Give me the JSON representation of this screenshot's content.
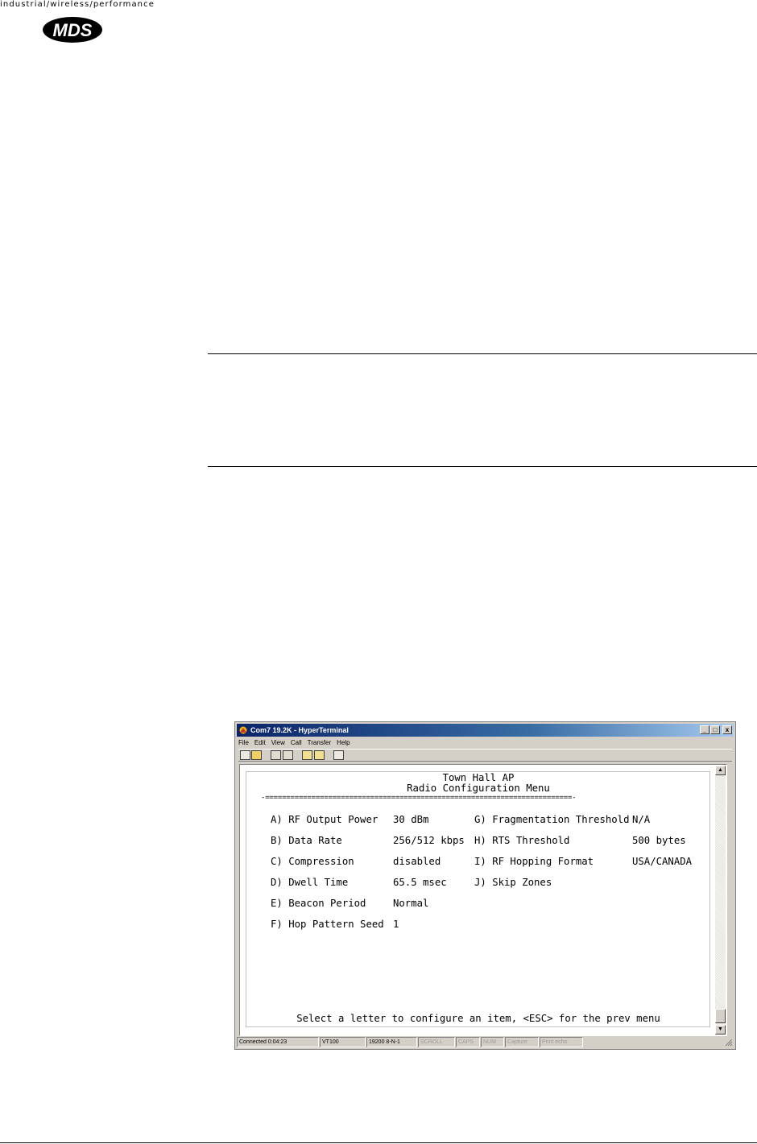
{
  "header": {
    "tagline": "industrial/wireless/performance",
    "logo_text": "MDS"
  },
  "window": {
    "title": "Com7 19.2K - HyperTerminal",
    "controls": {
      "minimize": "_",
      "maximize": "□",
      "close": "x"
    },
    "menu": [
      "File",
      "Edit",
      "View",
      "Call",
      "Transfer",
      "Help"
    ],
    "toolbar_icons": [
      "new-icon",
      "open-icon",
      "phone-icon",
      "disconnect-icon",
      "send-icon",
      "receive-icon",
      "properties-icon"
    ]
  },
  "terminal": {
    "device_name": "Town Hall AP",
    "menu_title": "Radio Configuration Menu",
    "separator": "-=========================================================================-",
    "left_items": [
      {
        "label": "A) RF Output Power",
        "value": "30 dBm"
      },
      {
        "label": "B) Data Rate",
        "value": "256/512 kbps"
      },
      {
        "label": "C) Compression",
        "value": "disabled"
      },
      {
        "label": "D) Dwell Time",
        "value": "65.5 msec"
      },
      {
        "label": "E) Beacon Period",
        "value": "Normal"
      },
      {
        "label": "F) Hop Pattern Seed",
        "value": "1"
      }
    ],
    "right_items": [
      {
        "label": "G) Fragmentation Threshold",
        "value": "N/A"
      },
      {
        "label": "H) RTS Threshold",
        "value": "500 bytes"
      },
      {
        "label": "I) RF Hopping Format",
        "value": "USA/CANADA"
      },
      {
        "label": "J) Skip Zones",
        "value": ""
      }
    ],
    "prompt": "Select a letter to configure an item, <ESC> for the prev menu"
  },
  "status_bar": {
    "connected": "Connected 0:04:23",
    "emulation": "VT100",
    "port_settings": "19200 8-N-1",
    "scroll": "SCROLL",
    "caps": "CAPS",
    "num": "NUM",
    "capture": "Capture",
    "print_echo": "Print echo"
  }
}
